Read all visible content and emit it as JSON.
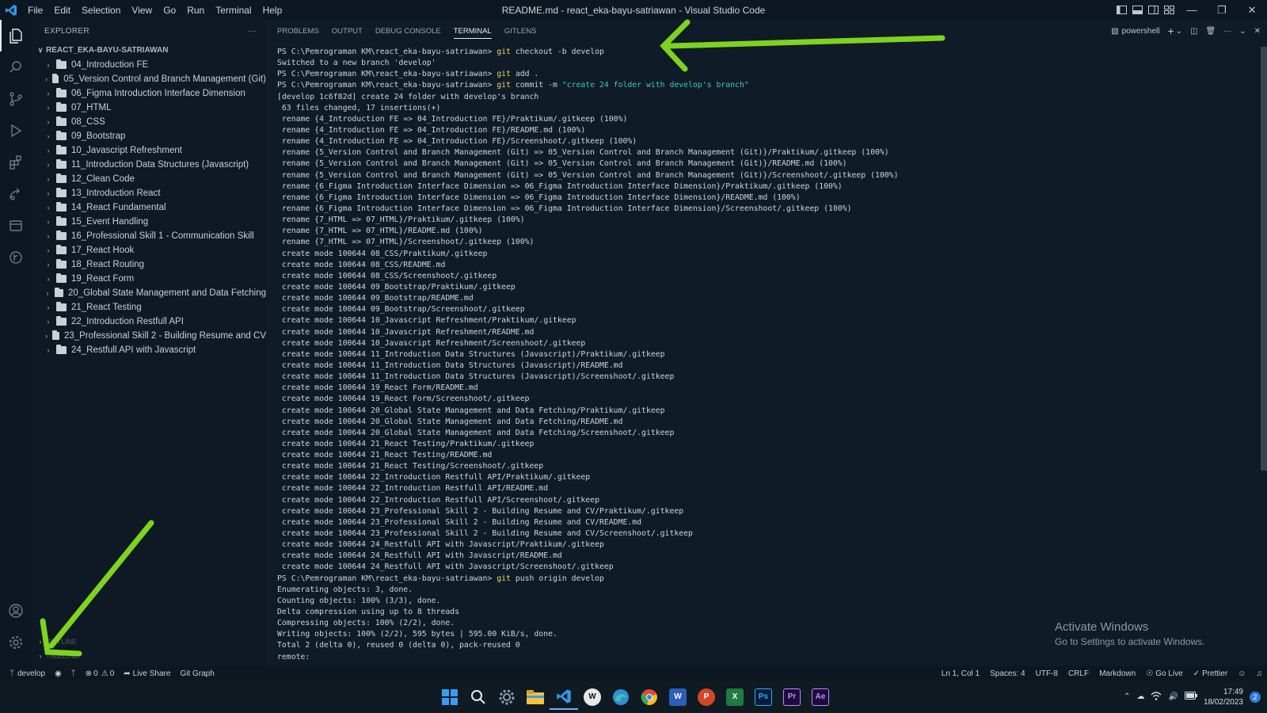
{
  "titlebar": {
    "menu": [
      "File",
      "Edit",
      "Selection",
      "View",
      "Go",
      "Run",
      "Terminal",
      "Help"
    ],
    "title": "README.md - react_eka-bayu-satriawan - Visual Studio Code"
  },
  "sidebar": {
    "header": "EXPLORER",
    "more": "···",
    "root": "REACT_EKA-BAYU-SATRIAWAN",
    "items": [
      "04_Introduction FE",
      "05_Version Control and Branch Management (Git)",
      "06_Figma Introduction Interface Dimension",
      "07_HTML",
      "08_CSS",
      "09_Bootstrap",
      "10_Javascript Refreshment",
      "11_Introduction Data Structures (Javascript)",
      "12_Clean Code",
      "13_Introduction React",
      "14_React Fundamental",
      "15_Event Handling",
      "16_Professional Skill 1 - Communication Skill",
      "17_React Hook",
      "18_React Routing",
      "19_React Form",
      "20_Global State Management and Data Fetching",
      "21_React Testing",
      "22_Introduction Restfull API",
      "23_Professional Skill 2 - Building Resume and CV",
      "24_Restfull API with Javascript"
    ],
    "outline": "OUTLINE",
    "timeline": "TIMELINE"
  },
  "panel": {
    "tabs": [
      "PROBLEMS",
      "OUTPUT",
      "DEBUG CONSOLE",
      "TERMINAL",
      "GITLENS"
    ],
    "active_tab": "TERMINAL",
    "shell": "powershell",
    "add": "+",
    "more": "···"
  },
  "terminal": {
    "lines": [
      {
        "prompt": "PS C:\\Pemrograman KM\\react_eka-bayu-satriawan> ",
        "cmd": "git",
        "rest": " checkout -b develop"
      },
      {
        "text": "Switched to a new branch 'develop'"
      },
      {
        "prompt": "PS C:\\Pemrograman KM\\react_eka-bayu-satriawan> ",
        "cmd": "git",
        "rest": " add ."
      },
      {
        "prompt": "PS C:\\Pemrograman KM\\react_eka-bayu-satriawan> ",
        "cmd": "git",
        "rest": " commit -m ",
        "str": "\"create 24 folder with develop's branch\""
      },
      {
        "text": "[develop 1c6f82d] create 24 folder with develop's branch"
      },
      {
        "text": " 63 files changed, 17 insertions(+)"
      },
      {
        "text": " rename {4_Introduction FE => 04_Introduction FE}/Praktikum/.gitkeep (100%)"
      },
      {
        "text": " rename {4_Introduction FE => 04_Introduction FE}/README.md (100%)"
      },
      {
        "text": " rename {4_Introduction FE => 04_Introduction FE}/Screenshoot/.gitkeep (100%)"
      },
      {
        "text": " rename {5_Version Control and Branch Management (Git) => 05_Version Control and Branch Management (Git)}/Praktikum/.gitkeep (100%)"
      },
      {
        "text": " rename {5_Version Control and Branch Management (Git) => 05_Version Control and Branch Management (Git)}/README.md (100%)"
      },
      {
        "text": " rename {5_Version Control and Branch Management (Git) => 05_Version Control and Branch Management (Git)}/Screenshoot/.gitkeep (100%)"
      },
      {
        "text": " rename {6_Figma Introduction Interface Dimension => 06_Figma Introduction Interface Dimension}/Praktikum/.gitkeep (100%)"
      },
      {
        "text": " rename {6_Figma Introduction Interface Dimension => 06_Figma Introduction Interface Dimension}/README.md (100%)"
      },
      {
        "text": " rename {6_Figma Introduction Interface Dimension => 06_Figma Introduction Interface Dimension}/Screenshoot/.gitkeep (100%)"
      },
      {
        "text": " rename {7_HTML => 07_HTML}/Praktikum/.gitkeep (100%)"
      },
      {
        "text": " rename {7_HTML => 07_HTML}/README.md (100%)"
      },
      {
        "text": " rename {7_HTML => 07_HTML}/Screenshoot/.gitkeep (100%)"
      },
      {
        "text": " create mode 100644 08_CSS/Praktikum/.gitkeep"
      },
      {
        "text": " create mode 100644 08_CSS/README.md"
      },
      {
        "text": " create mode 100644 08_CSS/Screenshoot/.gitkeep"
      },
      {
        "text": " create mode 100644 09_Bootstrap/Praktikum/.gitkeep"
      },
      {
        "text": " create mode 100644 09_Bootstrap/README.md"
      },
      {
        "text": " create mode 100644 09_Bootstrap/Screenshoot/.gitkeep"
      },
      {
        "text": " create mode 100644 10_Javascript Refreshment/Praktikum/.gitkeep"
      },
      {
        "text": " create mode 100644 10_Javascript Refreshment/README.md"
      },
      {
        "text": " create mode 100644 10_Javascript Refreshment/Screenshoot/.gitkeep"
      },
      {
        "text": " create mode 100644 11_Introduction Data Structures (Javascript)/Praktikum/.gitkeep"
      },
      {
        "text": " create mode 100644 11_Introduction Data Structures (Javascript)/README.md"
      },
      {
        "text": " create mode 100644 11_Introduction Data Structures (Javascript)/Screenshoot/.gitkeep"
      },
      {
        "text": " create mode 100644 19_React Form/README.md"
      },
      {
        "text": " create mode 100644 19_React Form/Screenshoot/.gitkeep"
      },
      {
        "text": " create mode 100644 20_Global State Management and Data Fetching/Praktikum/.gitkeep"
      },
      {
        "text": " create mode 100644 20_Global State Management and Data Fetching/README.md"
      },
      {
        "text": " create mode 100644 20_Global State Management and Data Fetching/Screenshoot/.gitkeep"
      },
      {
        "text": " create mode 100644 21_React Testing/Praktikum/.gitkeep"
      },
      {
        "text": " create mode 100644 21_React Testing/README.md"
      },
      {
        "text": " create mode 100644 21_React Testing/Screenshoot/.gitkeep"
      },
      {
        "text": " create mode 100644 22_Introduction Restfull API/Praktikum/.gitkeep"
      },
      {
        "text": " create mode 100644 22_Introduction Restfull API/README.md"
      },
      {
        "text": " create mode 100644 22_Introduction Restfull API/Screenshoot/.gitkeep"
      },
      {
        "text": " create mode 100644 23_Professional Skill 2 - Building Resume and CV/Praktikum/.gitkeep"
      },
      {
        "text": " create mode 100644 23_Professional Skill 2 - Building Resume and CV/README.md"
      },
      {
        "text": " create mode 100644 23_Professional Skill 2 - Building Resume and CV/Screenshoot/.gitkeep"
      },
      {
        "text": " create mode 100644 24_Restfull API with Javascript/Praktikum/.gitkeep"
      },
      {
        "text": " create mode 100644 24_Restfull API with Javascript/README.md"
      },
      {
        "text": " create mode 100644 24_Restfull API with Javascript/Screenshoot/.gitkeep"
      },
      {
        "prompt": "PS C:\\Pemrograman KM\\react_eka-bayu-satriawan> ",
        "cmd": "git",
        "rest": " push origin develop"
      },
      {
        "text": "Enumerating objects: 3, done."
      },
      {
        "text": "Counting objects: 100% (3/3), done."
      },
      {
        "text": "Delta compression using up to 8 threads"
      },
      {
        "text": "Compressing objects: 100% (2/2), done."
      },
      {
        "text": "Writing objects: 100% (2/2), 595 bytes | 595.00 KiB/s, done."
      },
      {
        "text": "Total 2 (delta 0), reused 0 (delta 0), pack-reused 0"
      },
      {
        "text": "remote:"
      }
    ]
  },
  "watermark": {
    "line1": "Activate Windows",
    "line2": "Go to Settings to activate Windows."
  },
  "statusbar": {
    "branch": "develop",
    "errors": "0",
    "warnings": "0",
    "live_share": "Live Share",
    "git_graph": "Git Graph",
    "position": "Ln 1, Col 1",
    "spaces": "Spaces: 4",
    "encoding": "UTF-8",
    "eol": "CRLF",
    "language": "Markdown",
    "go_live": "Go Live",
    "prettier": "Prettier"
  },
  "taskbar": {
    "time": "17:49",
    "date": "18/02/2023",
    "notifications": "2",
    "apps": [
      {
        "name": "start-icon",
        "color": "#3a9cf0"
      },
      {
        "name": "search-icon",
        "color": "#e8e8e8"
      },
      {
        "name": "settings-icon",
        "color": "#8aa0b5"
      },
      {
        "name": "file-explorer-icon",
        "color": "#f4c23a"
      },
      {
        "name": "vscode-icon",
        "color": "#2f9ae8"
      },
      {
        "name": "app-w-icon",
        "color": "#e8e8e8"
      },
      {
        "name": "edge-icon",
        "color": "#2fb8a8"
      },
      {
        "name": "chrome-icon",
        "color": "#e8b42a"
      },
      {
        "name": "word-icon",
        "color": "#2b5fb8"
      },
      {
        "name": "powerpoint-icon",
        "color": "#d24826"
      },
      {
        "name": "excel-icon",
        "color": "#1f7a43"
      },
      {
        "name": "photoshop-icon",
        "color": "#0a1c3a"
      },
      {
        "name": "premiere-icon",
        "color": "#1d0b3a"
      },
      {
        "name": "after-effects-icon",
        "color": "#1d0b3a"
      }
    ],
    "app_letters": {
      "word": "W",
      "powerpoint": "P",
      "excel": "X",
      "photoshop": "Ps",
      "premiere": "Pr",
      "after_effects": "Ae"
    }
  },
  "colors": {
    "background": "#0f1b26",
    "annotation_arrow": "#7ed321",
    "prompt_cmd": "#e9d46a",
    "string": "#3ec7c7"
  }
}
